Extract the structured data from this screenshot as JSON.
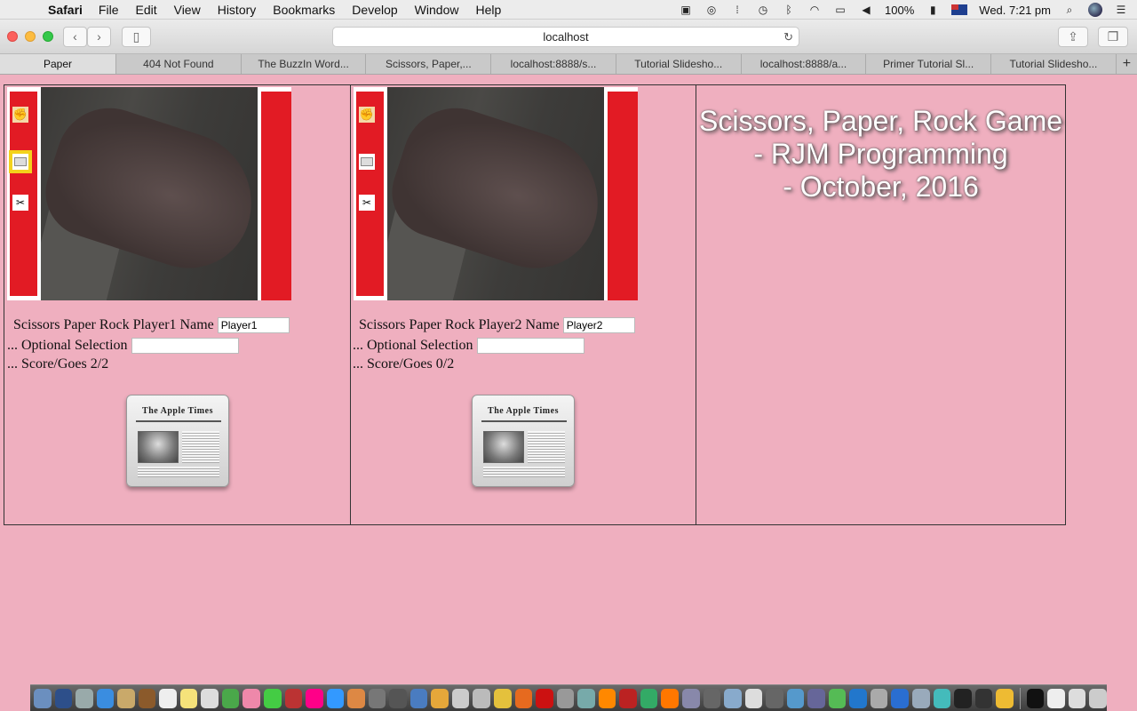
{
  "menubar": {
    "app": "Safari",
    "items": [
      "File",
      "Edit",
      "View",
      "History",
      "Bookmarks",
      "Develop",
      "Window",
      "Help"
    ],
    "battery": "100%",
    "clock": "Wed. 7:21 pm"
  },
  "toolbar": {
    "url": "localhost"
  },
  "tabs": [
    "Paper",
    "404 Not Found",
    "The BuzzIn Word...",
    "Scissors, Paper,...",
    "localhost:8888/s...",
    "Tutorial Slidesho...",
    "localhost:8888/a...",
    "Primer Tutorial Sl...",
    "Tutorial Slidesho..."
  ],
  "new_tab_glyph": "+",
  "player1": {
    "name_label": "Scissors Paper Rock Player1 Name",
    "name_value": "Player1",
    "selection_label": "... Optional Selection",
    "selection_value": "",
    "score_label": "... Score/Goes 2/2",
    "selected_option": "paper"
  },
  "player2": {
    "name_label": "Scissors Paper Rock Player2 Name",
    "name_value": "Player2",
    "selection_label": "... Optional Selection",
    "selection_value": "",
    "score_label": "... Score/Goes 0/2",
    "selected_option": ""
  },
  "newspaper_masthead": "The Apple Times",
  "title": {
    "line1": "Scissors, Paper, Rock Game",
    "line2": "- RJM Programming",
    "line3": "- October, 2016"
  },
  "icons": {
    "rock": "rock-hand-icon",
    "paper": "newspaper-icon",
    "scissors": "scissors-icon"
  },
  "colors": {
    "page_background": "#efafbf",
    "option_bar_red": "#e21b24",
    "selection_highlight": "#f3d21c",
    "title_text": "#ffffff"
  }
}
